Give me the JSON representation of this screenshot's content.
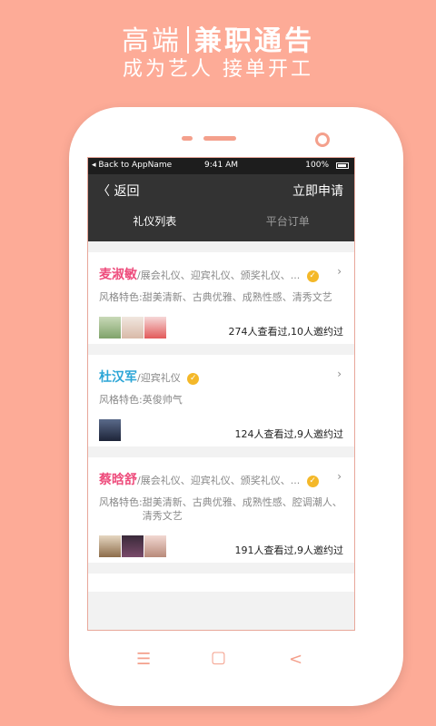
{
  "promo": {
    "title_left": "高端",
    "title_right": "兼职通告",
    "subtitle": "成为艺人 接单开工"
  },
  "status_bar": {
    "back_text": "◂ Back to AppName",
    "time": "9:41 AM",
    "battery": "100%"
  },
  "nav": {
    "back_label": "返回",
    "apply_label": "立即申请"
  },
  "tabs": [
    {
      "label": "礼仪列表",
      "active": true
    },
    {
      "label": "平台订单",
      "active": false
    }
  ],
  "cards": [
    {
      "name": "麦淑敏",
      "name_color": "pink",
      "roles": "/展会礼仪、迎宾礼仪、颁奖礼仪、...",
      "style_label": "风格特色:",
      "style_value": "甜美清新、古典优雅、成熟性感、清秀文艺",
      "views": "274人查看过,10人邀约过"
    },
    {
      "name": "杜汉军",
      "name_color": "blue",
      "roles": "/迎宾礼仪",
      "style_label": "风格特色:",
      "style_value": "英俊帅气",
      "views": "124人查看过,9人邀约过"
    },
    {
      "name": "蔡晗舒",
      "name_color": "pink",
      "roles": "/展会礼仪、迎宾礼仪、颁奖礼仪、...",
      "style_label": "风格特色:",
      "style_value": "甜美清新、古典优雅、成熟性感、腔调潮人、清秀文艺",
      "views": "191人查看过,9人邀约过"
    }
  ],
  "colors": {
    "background": "#fdab97",
    "pink_name": "#ee4c7c",
    "blue_name": "#2ba5d6",
    "badge": "#f4b829",
    "nav_bar": "#333333"
  }
}
